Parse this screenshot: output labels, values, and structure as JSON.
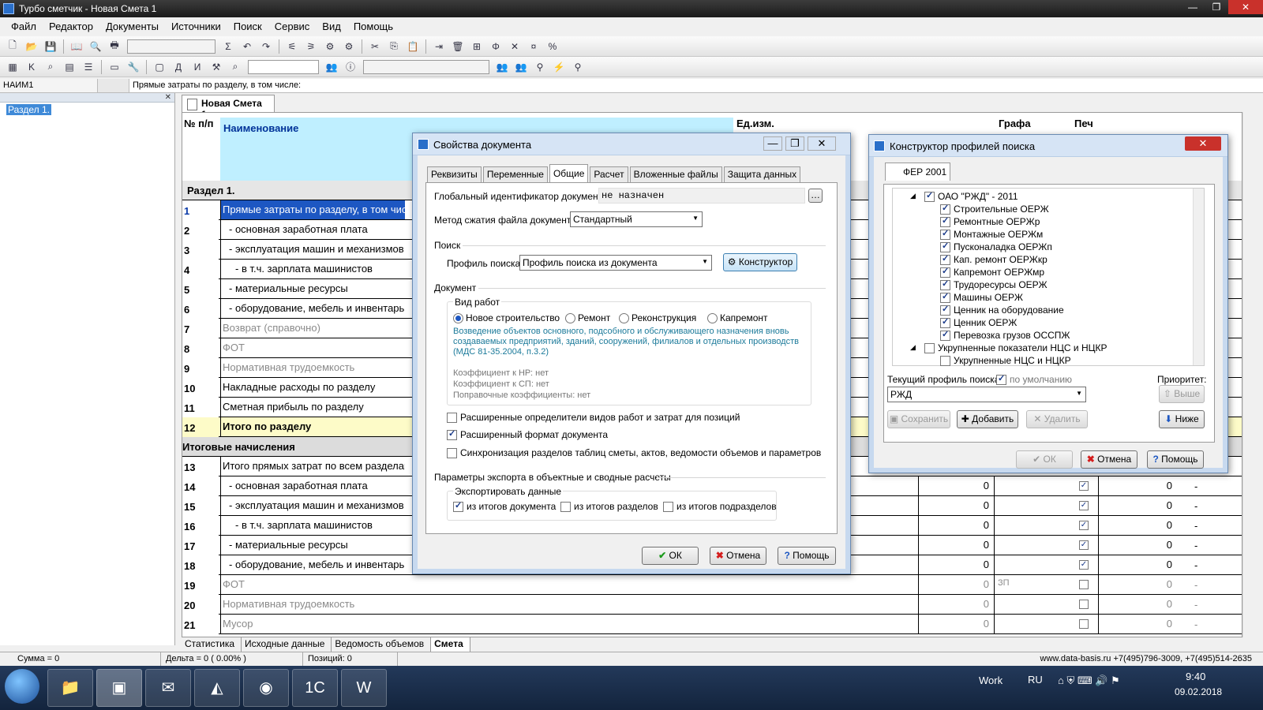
{
  "app": {
    "title": "Турбо сметчик - Новая Смета 1"
  },
  "menu": [
    "Файл",
    "Редактор",
    "Документы",
    "Источники",
    "Поиск",
    "Сервис",
    "Вид",
    "Помощь"
  ],
  "formula": {
    "cell": "НАИМ1",
    "text": "Прямые затраты по разделу, в том числе:"
  },
  "tree": {
    "node": "Раздел 1."
  },
  "doc_tab": "Новая Смета 1",
  "grid": {
    "headers": {
      "num": "№ п/п",
      "name": "Наименование",
      "unit": "Ед.изм.",
      "grafa": "Графа",
      "pech": "Печ"
    },
    "section1": "Раздел 1.",
    "rows": [
      {
        "n": "1",
        "name": "Прямые затраты по разделу, в том числе:"
      },
      {
        "n": "2",
        "name": "- основная заработная плата"
      },
      {
        "n": "3",
        "name": "- эксплуатация машин и механизмов"
      },
      {
        "n": "4",
        "name": "- в т.ч. зарплата машинистов"
      },
      {
        "n": "5",
        "name": "- материальные ресурсы"
      },
      {
        "n": "6",
        "name": "- оборудование, мебель и инвентарь"
      },
      {
        "n": "7",
        "name": "Возврат (справочно)"
      },
      {
        "n": "8",
        "name": "ФОТ"
      },
      {
        "n": "9",
        "name": "Нормативная трудоемкость"
      },
      {
        "n": "10",
        "name": "Накладные расходы по разделу"
      },
      {
        "n": "11",
        "name": "Сметная прибыль по разделу"
      },
      {
        "n": "12",
        "name": "Итого по разделу"
      }
    ],
    "section2": "Итоговые начисления",
    "rows2": [
      {
        "n": "13",
        "name": "Итого прямых затрат по всем разделам"
      },
      {
        "n": "14",
        "name": "- основная заработная плата",
        "v": "0",
        "v2": "0",
        "dash": "-"
      },
      {
        "n": "15",
        "name": "- эксплуатация машин и механизмов",
        "v": "0",
        "v2": "0",
        "dash": "-"
      },
      {
        "n": "16",
        "name": "- в т.ч. зарплата машинистов",
        "v": "0",
        "v2": "0",
        "dash": "-"
      },
      {
        "n": "17",
        "name": "- материальные ресурсы",
        "v": "0",
        "v2": "0",
        "dash": "-"
      },
      {
        "n": "18",
        "name": "- оборудование, мебель и инвентарь",
        "v": "0",
        "v2": "0",
        "dash": "-"
      },
      {
        "n": "19",
        "name": "ФОТ",
        "v": "0",
        "v2": "0",
        "dash": "-",
        "g": "ЗП"
      },
      {
        "n": "20",
        "name": "Нормативная трудоемкость",
        "v": "0",
        "v2": "0",
        "dash": "-"
      },
      {
        "n": "21",
        "name": "Мусор",
        "v": "0",
        "v2": "0",
        "dash": "-"
      }
    ]
  },
  "bottom_tabs": [
    "Статистика",
    "Исходные данные",
    "Ведомость объемов",
    "Смета"
  ],
  "status": {
    "sum": "Сумма = 0",
    "delta": "Дельта = 0 ( 0.00% )",
    "pos": "Позиций: 0",
    "contact": "www.data-basis.ru  +7(495)796-3009, +7(495)514-2635"
  },
  "props": {
    "title": "Свойства документа",
    "tabs": [
      "Реквизиты",
      "Переменные",
      "Общие",
      "Расчет",
      "Вложенные файлы",
      "Защита данных"
    ],
    "guid_label": "Глобальный идентификатор документа:",
    "guid_value": "не назначен",
    "compress_label": "Метод сжатия файла документа:",
    "compress_value": "Стандартный",
    "search_group": "Поиск",
    "profile_label": "Профиль поиска:",
    "profile_value": "Профиль поиска из документа",
    "constructor_btn": "Конструктор",
    "doc_group": "Документ",
    "work_group": "Вид работ",
    "radios": [
      "Новое строительство",
      "Ремонт",
      "Реконструкция",
      "Капремонт"
    ],
    "desc": "Возведение объектов основного, подсобного и обслуживающего назначения вновь создаваемых предприятий, зданий, сооружений, филиалов и отдельных производств (МДС 81-35.2004, п.3.2)",
    "k1": "Коэффициент к НР: нет",
    "k2": "Коэффициент к СП: нет",
    "k3": "Поправочные коэффициенты: нет",
    "chk1": "Расширенные определители видов работ и затрат для  позиций",
    "chk2": "Расширенный формат документа",
    "chk3": "Синхронизация разделов таблиц сметы, актов, ведомости объемов и параметров",
    "export_group": "Параметры экспорта в объектные и сводные расчеты",
    "export_sub": "Экспортировать данные",
    "exp1": "из итогов документа",
    "exp2": "из итогов разделов",
    "exp3": "из итогов подразделов",
    "ok": "ОК",
    "cancel": "Отмена",
    "help": "Помощь"
  },
  "profile": {
    "title": "Конструктор профилей поиска",
    "tab": "ФЕР 2001",
    "root": "ОАО \"РЖД\" - 2011",
    "items": [
      "Строительные ОЕРЖ",
      "Ремонтные ОЕРЖр",
      "Монтажные ОЕРЖм",
      "Пусконаладка ОЕРЖп",
      "Кап. ремонт ОЕРЖкр",
      "Капремонт ОЕРЖмр",
      "Трудоресурсы ОЕРЖ",
      "Машины ОЕРЖ",
      "Ценник на оборудование",
      "Ценник ОЕРЖ",
      "Перевозка грузов ОССПЖ"
    ],
    "root2": "Укрупненные показатели НЦС и НЦКР",
    "item2": "Укрупненные НЦС и НЦКР",
    "current_label": "Текущий профиль поиска:",
    "default_label": "по умолчанию",
    "priority_label": "Приоритет:",
    "current_value": "РЖД",
    "up": "Выше",
    "down": "Ниже",
    "save": "Сохранить",
    "add": "Добавить",
    "delete": "Удалить",
    "ok": "ОК",
    "cancel": "Отмена",
    "help": "Помощь"
  },
  "tray": {
    "work": "Work",
    "lang": "RU",
    "time": "9:40",
    "date": "09.02.2018"
  }
}
